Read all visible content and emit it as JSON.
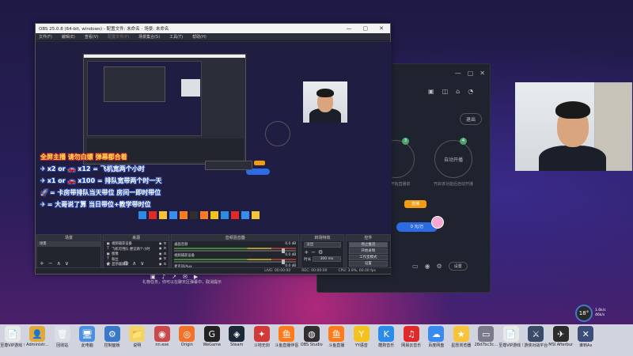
{
  "obs": {
    "title": "OBS 25.0.8 (64-bit, windows) - 配置文件: 未命名 - 场景: 未命名",
    "menus": [
      "文件(F)",
      "编辑(E)",
      "查看(V)",
      "配置文件(P)",
      "场景集合(S)",
      "工具(T)",
      "帮助(H)"
    ],
    "docks": {
      "scenes_title": "场景",
      "sources_title": "来源",
      "mixer_title": "音频混音器",
      "transitions_title": "转场特效",
      "controls_title": "控件"
    },
    "scene_item": "场景",
    "sources": [
      {
        "icon": "▣",
        "name": "视频捕获设备"
      },
      {
        "icon": "T",
        "name": "飞机可用队 便宜两个小时"
      },
      {
        "icon": "▣",
        "name": "图像"
      },
      {
        "icon": "T",
        "name": "粉丝"
      },
      {
        "icon": "▣",
        "name": "显示器捕获"
      }
    ],
    "mixer": [
      {
        "name": "桌面音频",
        "db": "0.0 dB"
      },
      {
        "name": "视频捕获设备",
        "db": "0.0 dB"
      },
      {
        "name": "麦克风/Aux",
        "db": "0.0 dB"
      }
    ],
    "transition": {
      "type": "淡出",
      "duration_label": "时长",
      "duration": "300 ms"
    },
    "controls": [
      "停止推流",
      "开始录制",
      "工作室模式",
      "设置",
      "退出"
    ],
    "status": {
      "live": "LIVE: 00:00:00",
      "rec": "REC: 00:00:00",
      "cpu": "CPU: 3.9%, 60.00 fps"
    }
  },
  "chat": {
    "header": "全屏主播 请勿白嫖 弹幕都合着",
    "lines": [
      {
        "emoji": "✈",
        "text": "x2 or 🚗 x12 = 飞机宽两个小时"
      },
      {
        "emoji": "✈",
        "text": "x1 or 🚗 x100 = 排队宽带两个时一天"
      },
      {
        "emoji": "🚀",
        "text": "= 卡房带排队当天带位 房间一即时带位"
      },
      {
        "emoji": "✈",
        "text": "= 大哥说了算 当日带位+教学带时位"
      }
    ]
  },
  "app2": {
    "logout": "退出",
    "circle1": "",
    "circle2": "自动开播",
    "desc1": "开始直播前",
    "desc2": "开启该功能后自动开播",
    "orange": "直播",
    "bluebar": "0 元/万",
    "settings": "设置"
  },
  "notify": "礼物任务，你可以在聊天区弹幕中，取消提示",
  "cpu": {
    "temp": "18°",
    "line1": "1.6k/s",
    "line2": "46k/s"
  },
  "taskbar": [
    {
      "label": "至尊VIP游戏 领域.txt",
      "color": "#e8e8e8",
      "glyph": "📄"
    },
    {
      "label": "Administr...",
      "color": "#e0a93a",
      "glyph": "👤"
    },
    {
      "label": "回收站",
      "color": "#d8dde6",
      "glyph": "🗑"
    },
    {
      "label": "此电脑",
      "color": "#4a8fe0",
      "glyph": "🖥"
    },
    {
      "label": "控制面板",
      "color": "#3a78c8",
      "glyph": "⚙"
    },
    {
      "label": "说明",
      "color": "#f0d36a",
      "glyph": "📁"
    },
    {
      "label": "nn.exe",
      "color": "#c94a4a",
      "glyph": "◉"
    },
    {
      "label": "Origin",
      "color": "#f2722b",
      "glyph": "◎"
    },
    {
      "label": "WeGame",
      "color": "#222",
      "glyph": "G"
    },
    {
      "label": "Steam",
      "color": "#1b2838",
      "glyph": "◈"
    },
    {
      "label": "斗地无剑",
      "color": "#d23a3a",
      "glyph": "✦"
    },
    {
      "label": "斗鱼直播伴侣",
      "color": "#ff7a1a",
      "glyph": "鱼"
    },
    {
      "label": "OBS Studio",
      "color": "#302e31",
      "glyph": "◍"
    },
    {
      "label": "斗鱼直播",
      "color": "#ff7a1a",
      "glyph": "鱼"
    },
    {
      "label": "YY语音",
      "color": "#f4c21d",
      "glyph": "Y"
    },
    {
      "label": "酷狗音乐",
      "color": "#2b8be9",
      "glyph": "K"
    },
    {
      "label": "网易云音乐",
      "color": "#e02a2a",
      "glyph": "♫"
    },
    {
      "label": "百度网盘",
      "color": "#3a8bf0",
      "glyph": "☁"
    },
    {
      "label": "星愿浏览器",
      "color": "#f6c33a",
      "glyph": "★"
    },
    {
      "label": "28d7bc3c...",
      "color": "#7a7a8a",
      "glyph": "▭"
    },
    {
      "label": "至尊VIP游戏 领域1.txt",
      "color": "#e8e8e8",
      "glyph": "📄"
    },
    {
      "label": "游侠对战平台",
      "color": "#3c4a6a",
      "glyph": "⚔"
    },
    {
      "label": "MSI Afterburner",
      "color": "#2c2c2c",
      "glyph": "✈"
    },
    {
      "label": "谁到Ax",
      "color": "#3b4c78",
      "glyph": "✕"
    }
  ]
}
